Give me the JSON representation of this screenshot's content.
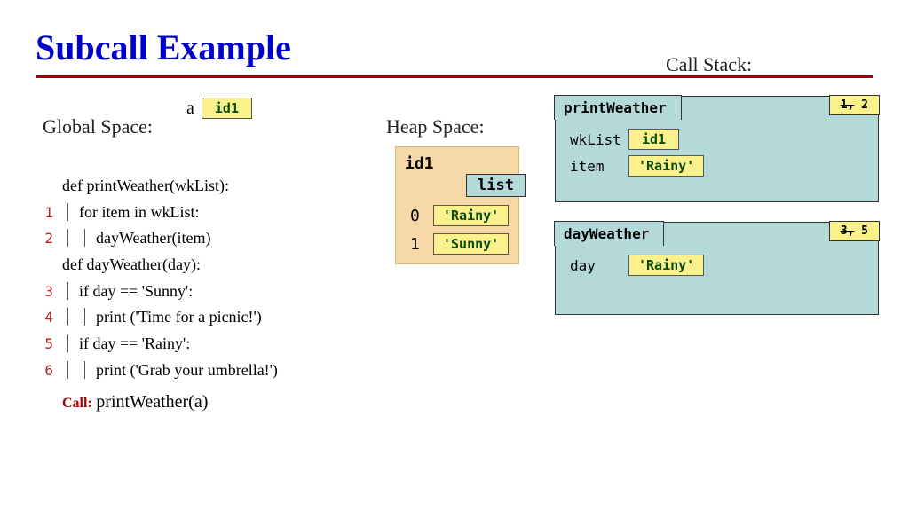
{
  "title": "Subcall Example",
  "callstack_label": "Call Stack:",
  "global": {
    "label": "Global Space:",
    "var_name": "a",
    "var_value": "id1"
  },
  "heap": {
    "label": "Heap Space:",
    "obj_id": "id1",
    "obj_type": "list",
    "slots": [
      {
        "index": "0",
        "value": "'Rainy'"
      },
      {
        "index": "1",
        "value": "'Sunny'"
      }
    ]
  },
  "code": {
    "lines": [
      {
        "n": "",
        "indent": 0,
        "text": "def printWeather(wkList):"
      },
      {
        "n": "1",
        "indent": 1,
        "text": "for item in wkList:"
      },
      {
        "n": "2",
        "indent": 2,
        "text": "dayWeather(item)"
      },
      {
        "n": "",
        "indent": 0,
        "text": "def dayWeather(day):"
      },
      {
        "n": "3",
        "indent": 1,
        "text": "if day == 'Sunny':"
      },
      {
        "n": "4",
        "indent": 2,
        "text": "print ('Time for a picnic!')"
      },
      {
        "n": "5",
        "indent": 1,
        "text": "if day == 'Rainy':"
      },
      {
        "n": "6",
        "indent": 2,
        "text": "print ('Grab your umbrella!')"
      }
    ],
    "call_label": "Call:",
    "call_text": "printWeather(a)"
  },
  "stack": [
    {
      "name": "printWeather",
      "step_old": "1,",
      "step_new": " 2",
      "vars": [
        {
          "name": "wkList",
          "value": "id1"
        },
        {
          "name": "item",
          "value": "'Rainy'"
        }
      ]
    },
    {
      "name": "dayWeather",
      "step_old": "3,",
      "step_new": " 5",
      "vars": [
        {
          "name": "day",
          "value": "'Rainy'"
        }
      ]
    }
  ]
}
